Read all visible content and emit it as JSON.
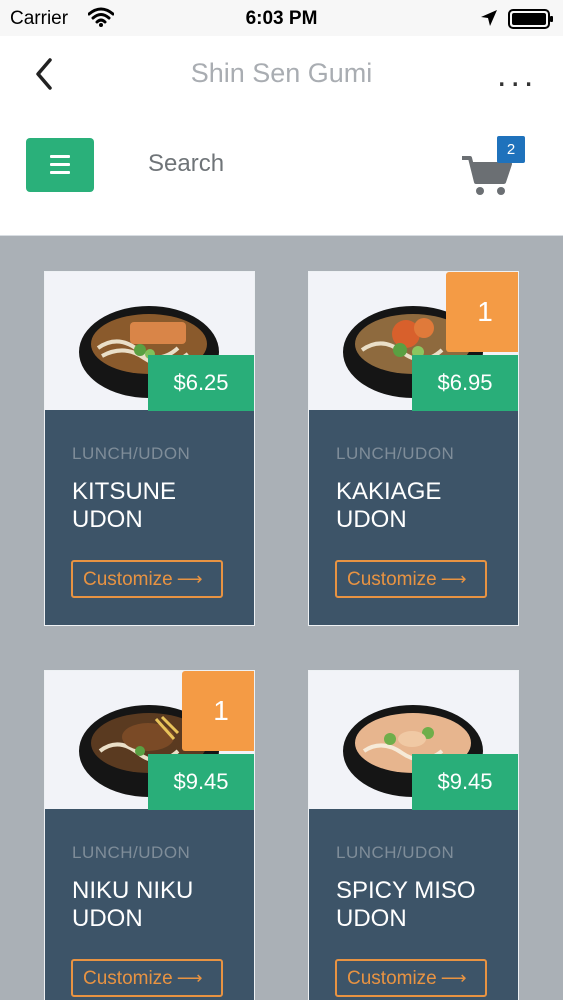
{
  "status_bar": {
    "carrier": "Carrier",
    "time": "6:03 PM"
  },
  "header": {
    "title": "Shin Sen Gumi",
    "more_label": "...",
    "search_placeholder": "Search",
    "cart_count": "2"
  },
  "products": [
    {
      "category": "LUNCH/UDON",
      "name": "KITSUNE UDON",
      "price": "$6.25",
      "quantity": "",
      "customize_label": "Customize",
      "soup_color": "#8a5a2c",
      "topping_color": "#d98548"
    },
    {
      "category": "LUNCH/UDON",
      "name": "KAKIAGE UDON",
      "price": "$6.95",
      "quantity": "1",
      "customize_label": "Customize",
      "soup_color": "#8e6a3e",
      "topping_color": "#d8602c"
    },
    {
      "category": "LUNCH/UDON",
      "name": "NIKU NIKU UDON",
      "price": "$9.45",
      "quantity": "1",
      "customize_label": "Customize",
      "soup_color": "#5a3a20",
      "topping_color": "#7a4a26"
    },
    {
      "category": "LUNCH/UDON",
      "name": "SPICY MISO UDON",
      "price": "$9.45",
      "quantity": "",
      "customize_label": "Customize",
      "soup_color": "#e7b58e",
      "topping_color": "#f0c9a4"
    }
  ],
  "colors": {
    "accent_green": "#2ab07a",
    "card_navy": "#3d5468",
    "quantity_orange": "#f49b45",
    "cart_badge_blue": "#1f72bc"
  }
}
